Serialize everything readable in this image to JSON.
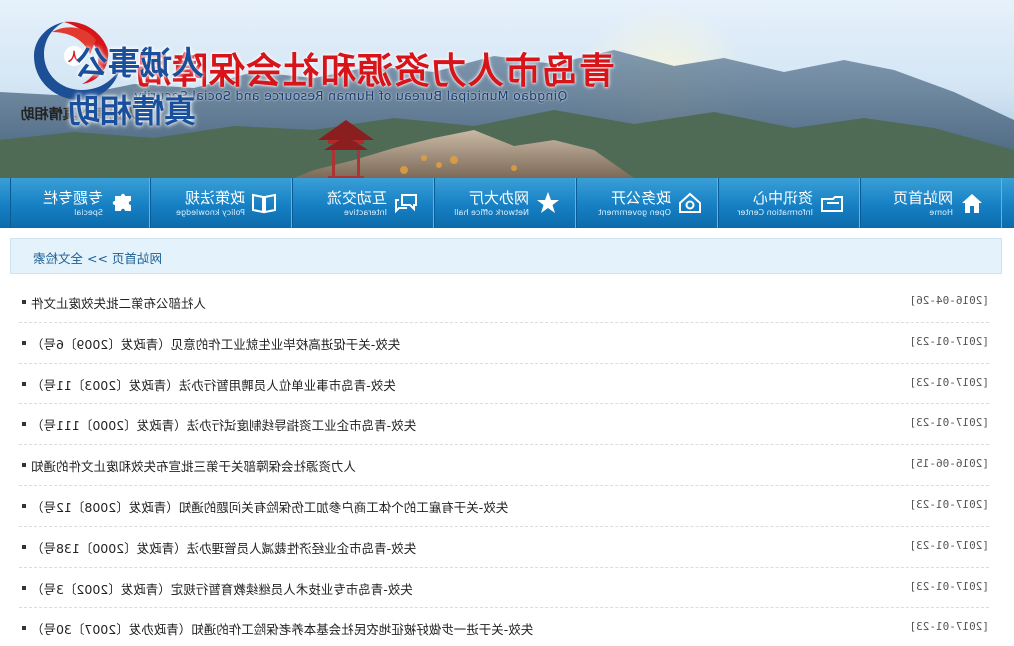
{
  "header": {
    "site_title": "青岛市人力资源和社会保障局",
    "site_title_en": "Qingdao Municipal Bureau of Human Resource and Social Security",
    "logo_motto": "人诚事公 真情相助",
    "slogan_line1": "人诚事公",
    "slogan_line2": "真情相助"
  },
  "nav": {
    "items": [
      {
        "zh": "网站首页",
        "en": "Home",
        "icon": "home-icon"
      },
      {
        "zh": "资讯中心",
        "en": "Information Center",
        "icon": "folder-icon"
      },
      {
        "zh": "政务公开",
        "en": "Open government",
        "icon": "eye-icon"
      },
      {
        "zh": "网办大厅",
        "en": "Network office hall",
        "icon": "star-icon"
      },
      {
        "zh": "互动交流",
        "en": "Interactive",
        "icon": "chat-icon"
      },
      {
        "zh": "政策法规",
        "en": "Policy knowledge",
        "icon": "book-icon"
      },
      {
        "zh": "专题专栏",
        "en": "Special",
        "icon": "puzzle-icon"
      }
    ]
  },
  "breadcrumb": {
    "home": "网站首页",
    "separator": ">>",
    "current": "全文检索"
  },
  "results": [
    {
      "title": "人社部公布第二批失效废止文件",
      "date": "[2016-04-26]"
    },
    {
      "title": "失效-关于促进高校毕业生就业工作的意见（青政发〔2009〕6号）",
      "date": "[2017-01-23]"
    },
    {
      "title": "失效-青岛市事业单位人员聘用暂行办法（青政发〔2003〕11号）",
      "date": "[2017-01-23]"
    },
    {
      "title": "失效-青岛市企业工资指导线制度试行办法（青政发〔2000〕111号）",
      "date": "[2017-01-23]"
    },
    {
      "title": "人力资源社会保障部关于第三批宣布失效和废止文件的通知",
      "date": "[2016-06-15]"
    },
    {
      "title": "失效-关于有雇工的个体工商户参加工伤保险有关问题的通知（青政发〔2008〕12号）",
      "date": "[2017-01-23]"
    },
    {
      "title": "失效-青岛市企业经济性裁减人员管理办法（青政发〔2000〕138号）",
      "date": "[2017-01-23]"
    },
    {
      "title": "失效-青岛市专业技术人员继续教育暂行规定（青政发〔2002〕3号）",
      "date": "[2017-01-23]"
    },
    {
      "title": "失效-关于进一步做好被征地农民社会基本养老保险工作的通知（青政办发〔2007〕30号）",
      "date": "[2017-01-23]"
    }
  ],
  "colors": {
    "nav_blue": "#1680c4",
    "brand_red": "#d7141a",
    "slogan_blue": "#1a4f9c",
    "crumb_bg": "#e4f2fb"
  }
}
